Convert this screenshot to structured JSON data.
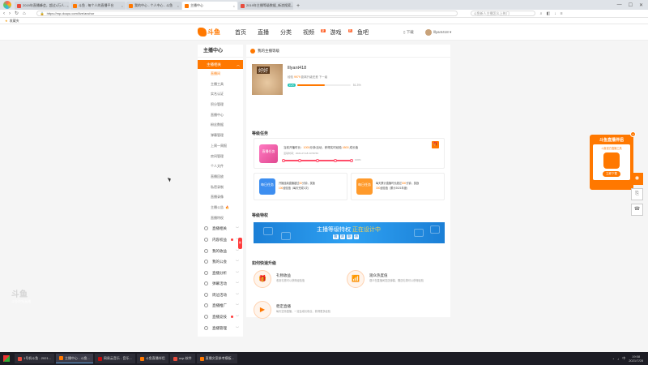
{
  "browser": {
    "tabs": [
      {
        "label": "2019年直播峰会，超过4万人...",
        "color": "#e84c3d",
        "active": false
      },
      {
        "label": "斗鱼 - 每个人的直播平台",
        "color": "#ff7800",
        "active": false
      },
      {
        "label": "我的中心 - 个人中心 - 斗鱼",
        "color": "#ff7800",
        "active": false
      },
      {
        "label": "主播中心",
        "color": "#ff7800",
        "active": true
      },
      {
        "label": "2019年主播等级数据_新浪搜索",
        "color": "#e84c3d",
        "active": false
      }
    ],
    "url_protocol": "https://",
    "url": "https://mp.douyu.com/live/anchor",
    "search_placeholder": "斗鱼新人主播怎么上热门",
    "bookmark_label": "收藏夹"
  },
  "site": {
    "logo_text": "斗鱼",
    "nav": [
      {
        "label": "首页",
        "badge": ""
      },
      {
        "label": "直播",
        "badge": ""
      },
      {
        "label": "分类",
        "badge": ""
      },
      {
        "label": "视频",
        "badge": "新"
      },
      {
        "label": "游戏",
        "badge": "热"
      },
      {
        "label": "鱼吧",
        "badge": ""
      }
    ],
    "header_right": [
      "下载",
      "lllyant418"
    ]
  },
  "sidebar": {
    "title": "主播中心",
    "active_group": "主播相关",
    "subitems": [
      {
        "label": "直播间",
        "hot": false,
        "current": true
      },
      {
        "label": "主播工具",
        "hot": false,
        "current": false
      },
      {
        "label": "实名认证",
        "hot": false,
        "current": false
      },
      {
        "label": "积分管理",
        "hot": false,
        "current": false
      },
      {
        "label": "直播中心",
        "hot": false,
        "current": false
      },
      {
        "label": "粉丝数据",
        "hot": false,
        "current": false
      },
      {
        "label": "弹幕管理",
        "hot": false,
        "current": false
      },
      {
        "label": "上周一周报",
        "hot": false,
        "current": false
      },
      {
        "label": "房间管理",
        "hot": false,
        "current": false
      },
      {
        "label": "个人文件",
        "hot": false,
        "current": false
      },
      {
        "label": "直播回放",
        "hot": false,
        "current": false
      },
      {
        "label": "私密录制",
        "hot": false,
        "current": false
      },
      {
        "label": "直播录像",
        "hot": false,
        "current": false
      },
      {
        "label": "主播公告",
        "hot": true,
        "current": false
      },
      {
        "label": "直播特权",
        "hot": false,
        "current": false
      }
    ],
    "groups": [
      {
        "label": "直播相关",
        "dot": false,
        "tag": ""
      },
      {
        "label": "内容权益",
        "dot": true,
        "tag": "新"
      },
      {
        "label": "我的收益",
        "dot": false,
        "tag": ""
      },
      {
        "label": "我的公会",
        "dot": false,
        "tag": ""
      },
      {
        "label": "直播分析",
        "dot": false,
        "tag": ""
      },
      {
        "label": "弹幕活动",
        "dot": false,
        "tag": ""
      },
      {
        "label": "周边活动",
        "dot": false,
        "tag": ""
      },
      {
        "label": "直播推广",
        "dot": false,
        "tag": ""
      },
      {
        "label": "直播竞技",
        "dot": true,
        "tag": ""
      },
      {
        "label": "直播管理",
        "dot": false,
        "tag": ""
      }
    ]
  },
  "main": {
    "header": "我的主播等级",
    "profile": {
      "name": "lllyant418",
      "line_prefix": "经验",
      "exp": "9979",
      "line_suffix": "距离升级还差 下一级",
      "level": "LV.5",
      "progress": 0.513,
      "progress_text": "51.3%"
    },
    "tasks_title": "等级任务",
    "task_main": {
      "icon_text": "直播任务",
      "line1_a": "当前开播时长：",
      "line1_hl": "1000",
      "line1_b": "分钟/活动，获得实时经验 ",
      "line1_hl2": "4500",
      "line1_c": " 成长值",
      "line2": "活动时间：2021-07-18 23:59:59",
      "progress_text": "100%"
    },
    "task_a": {
      "icon_text": "每日任务",
      "line1_a": "开播连续直播超过",
      "line1_hl": "60",
      "line1_b": "分钟，奖励",
      "line2_a": "",
      "line2_hl": "100",
      "line2_b": "经验值（每天完成1次）",
      "color": "#3d8ef0"
    },
    "task_b": {
      "icon_text": "每日任务",
      "line1_a": "每天累计直播时长超过",
      "line1_hl": "300",
      "line1_b": "分钟，奖励",
      "line2_a": "",
      "line2_hl": "300",
      "line2_b": "经验值（累计2021年度）",
      "color": "#ff9a2b"
    },
    "privilege_title": "等级特权",
    "banner": {
      "text_a": "主播等级特权 ",
      "text_b": "正在设计中",
      "chars": [
        "敬",
        "请",
        "期",
        "待"
      ]
    },
    "help_title": "如何快速升级",
    "help": [
      {
        "icon": "🎁",
        "title": "礼物收益",
        "desc": "收到礼物可以获得经验值"
      },
      {
        "icon": "📶",
        "title": "观众热度值",
        "desc": "观众在直播间发送弹幕、赠送礼物可以获得经验"
      },
      {
        "icon": "▶",
        "title": "稳定直播",
        "desc": "每天坚持直播，一定会增长粉丝、获得更多经验"
      }
    ]
  },
  "promo": {
    "title": "斗鱼直播伴侣",
    "subtitle": "斗鱼官方直播工具",
    "button": "立即下载"
  },
  "watermark": {
    "big": "斗鱼",
    "text": "斗鱼视频直播"
  },
  "taskbar": {
    "apps": [
      {
        "label": "1号机斗鱼 - 2021...",
        "color": "#e84c3d",
        "active": false
      },
      {
        "label": "主播中心 - 斗鱼...",
        "color": "#ff7800",
        "active": true
      },
      {
        "label": "网易云音乐 - 音乐...",
        "color": "#c20c0c",
        "active": false
      },
      {
        "label": "斗鱼直播伴侣",
        "color": "#ff7800",
        "active": false
      },
      {
        "label": "ocp-软件",
        "color": "#e84c3d",
        "active": false
      },
      {
        "label": "直播文案参考模板...",
        "color": "#ff7800",
        "active": false
      }
    ],
    "time": "19:58",
    "date": "2021/7/28"
  }
}
